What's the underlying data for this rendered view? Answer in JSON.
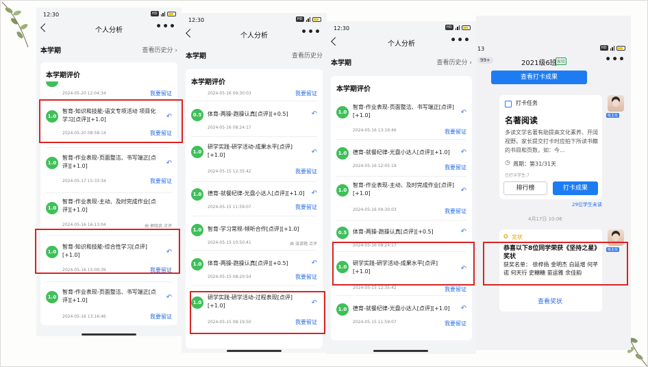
{
  "status": {
    "time": "12:30",
    "time4": "13"
  },
  "nav": {
    "title": "个人分析",
    "more": "•••",
    "semester": "本学期",
    "history": "查看历史分"
  },
  "eval_title": "本学期评价",
  "leave_label": "我要留证",
  "panel1": {
    "top_date": "2024-05-20 12:04:34",
    "items": [
      {
        "score": "1.0",
        "text": "智育-知识和技能-语文专项活动 项目化学习[点评][+1.0]",
        "date": "2024-05-20 08:58:14",
        "by": ""
      },
      {
        "score": "1.0",
        "text": "智育-作业表现-页面整洁、书写端正[点评][+1.0]",
        "date": "2024-05-17 15:33:34",
        "by": ""
      },
      {
        "score": "1.0",
        "text": "智育-作业表现-主动、及时完成作业[点评][+1.0]",
        "date": "2024-05-16 16:13:04",
        "by": "由 郭晓武 点评"
      },
      {
        "score": "1.0",
        "text": "智育-知识和技能-综合性学习[点评][+1.0]",
        "date": "2024-05-16 15:09:39",
        "by": ""
      },
      {
        "score": "1.0",
        "text": "智育-作业表现-页面整洁、书写端正[点评][+1.0]",
        "date": "2024-05-16 13:16:46",
        "by": ""
      }
    ]
  },
  "panel2": {
    "top_date": "2024-05-16 09:30:03",
    "items": [
      {
        "score": "0.5",
        "text": "体育-两操-跑操认真[点评][+0.5]",
        "date": "2024-05-16 08:24:17",
        "by": ""
      },
      {
        "score": "1.0",
        "text": "研学实践-研学活动-成果水平[点评][+1.0]",
        "date": "2024-05-15 12:35:42",
        "by": ""
      },
      {
        "score": "1.0",
        "text": "德育-就餐纪律-光盘小达人[点评][+1.0]",
        "date": "2024-05-15 11:59:07",
        "by": ""
      },
      {
        "score": "1.0",
        "text": "智育-学习常规-倾听合作[点评][+1.0]",
        "date": "2024-05-15 10:50:41",
        "by": "由 张淑艳 点评"
      },
      {
        "score": "1.0",
        "text": "体育-两操-跑操认真[点评][+0.5]",
        "date": "2024-05-15 08:20:54",
        "by": ""
      },
      {
        "score": "1.0",
        "text": "研学实践-研学活动-过程表现[点评][+1.0]",
        "date": "2024-05-15 08:19:50",
        "by": ""
      }
    ]
  },
  "panel3": {
    "items": [
      {
        "score": "1.0",
        "text": "智育-作业表现-页面整洁、书写端正[点评][+1.0]",
        "date": "2024-05-16 13:16:46"
      },
      {
        "score": "1.0",
        "text": "德育-就餐纪律-光盘小达人[点评][+1.0]",
        "date": "2024-05-16 12:05:19"
      },
      {
        "score": "1.0",
        "text": "智育-作业表现-主动、及时完成作业[点评][+1.0]",
        "date": "2024-05-16 09:30:03"
      },
      {
        "score": "0.5",
        "text": "体育-两操-跑操认真[点评][+0.5]",
        "date": "2024-05-16 08:24:17"
      },
      {
        "score": "1.0",
        "text": "研学实践-研学活动-成果水平[点评][+1.0]",
        "date": "2024-05-15 12:35:42"
      },
      {
        "score": "1.0",
        "text": "德育-就餐纪律-光盘小达人[点评][+1.0]",
        "date": "2024-05-15 11:59:07"
      }
    ]
  },
  "panel4": {
    "badge": "99+",
    "class_name": "2021级6班",
    "class_tag": "家校",
    "view_checkin": "查看打卡成果",
    "task_label": "打卡任务",
    "task_title": "名著阅读",
    "task_desc": "多读文学名著有助提高文化素养、开阔视野。家长提交打卡时应拍下所读书籍的书目和页数，如：今...",
    "cycle": "周期：第31/31天",
    "checked": "已打卡学生:7",
    "rank_btn": "排行榜",
    "result_btn": "打卡成果",
    "not_checked": "29位学生未读",
    "teacher_tag": "班主任",
    "date_sep": "4月17日 10:06",
    "award_label": "奖状",
    "award_title": "恭喜以下8位同学荣获《坚持之星》奖状",
    "award_names": "获奖名单：  徐梓扬  金明杰  白延增  何芊诺  何天行  史糖糖  苗运雅  余佳韵",
    "view_award": "查看奖状"
  },
  "colors": {
    "accent": "#1e7cf2",
    "score": "#3fbf5a",
    "highlight": "#d92121"
  }
}
